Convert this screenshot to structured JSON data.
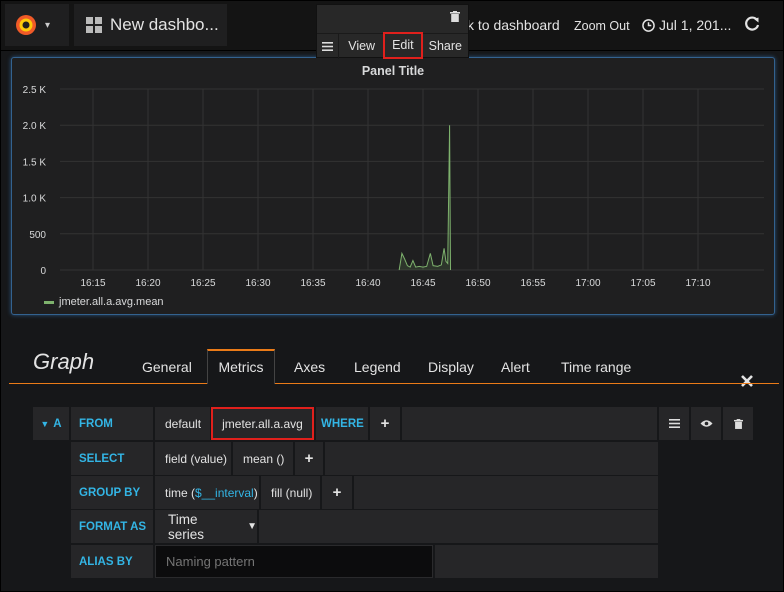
{
  "topnav": {
    "dashboard_title": "New dashbo...",
    "back_to_dashboard": "k to dashboard",
    "zoom_out": "Zoom Out",
    "time_range": "Jul 1, 201...",
    "icons": [
      "grafana-logo-icon",
      "caret-down-icon",
      "dashboard-grid-icon",
      "clock-icon",
      "refresh-icon"
    ]
  },
  "panel_menu": {
    "view": "View",
    "edit": "Edit",
    "share": "Share",
    "icons": [
      "trash-icon",
      "hamburger-icon"
    ]
  },
  "panel": {
    "title": "Panel Title"
  },
  "chart_data": {
    "type": "line",
    "title": "Panel Title",
    "xlabel": "",
    "ylabel": "",
    "y_ticks": [
      "0",
      "500",
      "1.0 K",
      "1.5 K",
      "2.0 K",
      "2.5 K"
    ],
    "y_tick_values": [
      0,
      500,
      1000,
      1500,
      2000,
      2500
    ],
    "ylim": [
      0,
      2500
    ],
    "x_ticks": [
      "16:15",
      "16:20",
      "16:25",
      "16:30",
      "16:35",
      "16:40",
      "16:45",
      "16:50",
      "16:55",
      "17:00",
      "17:05",
      "17:10"
    ],
    "xlim": [
      "16:12:00",
      "17:16:00"
    ],
    "grid": true,
    "legend_position": "bottom-left",
    "series": [
      {
        "name": "jmeter.all.a.avg.mean",
        "color": "#7eb26d",
        "points": [
          [
            "16:42:50",
            0
          ],
          [
            "16:43:05",
            230
          ],
          [
            "16:43:20",
            150
          ],
          [
            "16:43:35",
            60
          ],
          [
            "16:43:50",
            40
          ],
          [
            "16:44:05",
            130
          ],
          [
            "16:44:20",
            40
          ],
          [
            "16:44:40",
            50
          ],
          [
            "16:45:00",
            40
          ],
          [
            "16:45:20",
            50
          ],
          [
            "16:45:40",
            230
          ],
          [
            "16:45:55",
            60
          ],
          [
            "16:46:20",
            50
          ],
          [
            "16:46:40",
            70
          ],
          [
            "16:46:55",
            300
          ],
          [
            "16:47:05",
            120
          ],
          [
            "16:47:15",
            90
          ],
          [
            "16:47:25",
            2000
          ],
          [
            "16:47:30",
            0
          ]
        ]
      }
    ]
  },
  "editor": {
    "title": "Graph",
    "tabs": [
      "General",
      "Metrics",
      "Axes",
      "Legend",
      "Display",
      "Alert",
      "Time range"
    ],
    "active_tab": "Metrics",
    "close_icon": "close-icon"
  },
  "query": {
    "ref_id": "A",
    "from_label": "FROM",
    "policy": "default",
    "measurement": "jmeter.all.a.avg",
    "where_label": "WHERE",
    "select_label": "SELECT",
    "select_field": "field (value)",
    "select_fn": "mean ()",
    "group_by_label": "GROUP BY",
    "group_time_prefix": "time (",
    "group_time_interval": "$__interval",
    "group_time_suffix": ")",
    "group_fill": "fill (null)",
    "format_as_label": "FORMAT AS",
    "format_as_value": "Time series",
    "alias_by_label": "ALIAS BY",
    "alias_placeholder": "Naming pattern",
    "plus": "+"
  }
}
